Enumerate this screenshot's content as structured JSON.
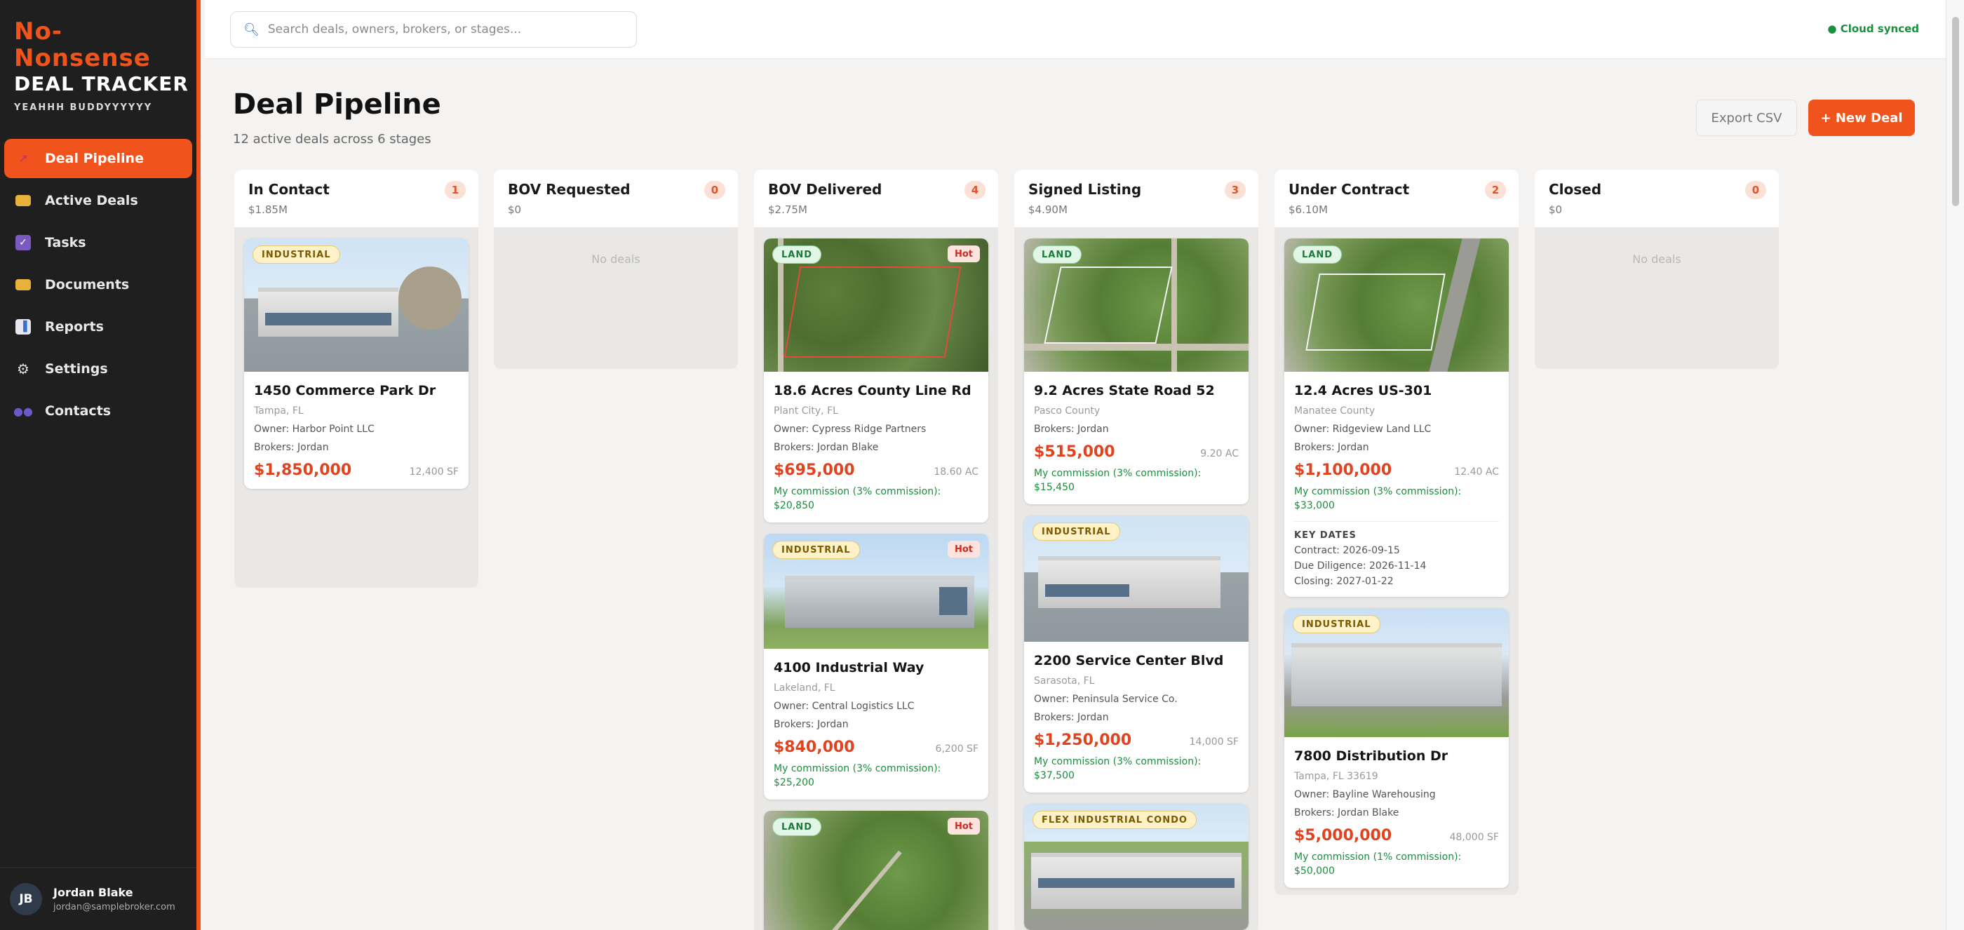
{
  "app": {
    "logo_line1": "No-",
    "logo_line2": "Nonsense",
    "logo_line3": "DEAL TRACKER",
    "tagline": "YEAHHH BUDDYYYYYY",
    "brand_color": "#f0541c"
  },
  "sidebar": {
    "items": [
      {
        "label": "Deal Pipeline",
        "icon": "pipeline-icon",
        "active": true
      },
      {
        "label": "Active Deals",
        "icon": "folder-icon",
        "active": false
      },
      {
        "label": "Tasks",
        "icon": "checkbox-icon",
        "active": false
      },
      {
        "label": "Documents",
        "icon": "folder-icon",
        "active": false
      },
      {
        "label": "Reports",
        "icon": "bar-chart-icon",
        "active": false
      },
      {
        "label": "Settings",
        "icon": "gear-icon",
        "active": false
      },
      {
        "label": "Contacts",
        "icon": "people-icon",
        "active": false
      }
    ],
    "user": {
      "initials": "JB",
      "name": "Jordan Blake",
      "email": "jordan@samplebroker.com"
    }
  },
  "topbar": {
    "search_placeholder": "Search deals, owners, brokers, or stages...",
    "sync_status": "● Cloud synced"
  },
  "header": {
    "title": "Deal Pipeline",
    "subtitle": "12 active deals across 6 stages",
    "export_label": "Export CSV",
    "new_deal_label": "+ New Deal"
  },
  "columns": [
    {
      "title": "In Contact",
      "count": "1",
      "total": "$1.85M",
      "cards": [
        {
          "tag": "INDUSTRIAL",
          "hot": "",
          "title": "1450 Commerce Park Dr",
          "location": "Tampa, FL",
          "owner": "Owner: Harbor Point LLC",
          "brokers": "Brokers: Jordan",
          "price": "$1,850,000",
          "size": "12,400 SF",
          "commission_1": "",
          "commission_2": ""
        }
      ]
    },
    {
      "title": "BOV Requested",
      "count": "0",
      "total": "$0",
      "empty_text": "No deals",
      "cards": []
    },
    {
      "title": "BOV Delivered",
      "count": "4",
      "total": "$2.75M",
      "cards": [
        {
          "tag": "LAND",
          "hot": "Hot",
          "title": "18.6 Acres County Line Rd",
          "location": "Plant City, FL",
          "owner": "Owner: Cypress Ridge Partners",
          "brokers": "Brokers: Jordan Blake",
          "price": "$695,000",
          "size": "18.60 AC",
          "commission_1": "My commission (3% commission):",
          "commission_2": "$20,850"
        },
        {
          "tag": "INDUSTRIAL",
          "hot": "Hot",
          "title": "4100 Industrial Way",
          "location": "Lakeland, FL",
          "owner": "Owner: Central Logistics LLC",
          "brokers": "Brokers: Jordan",
          "price": "$840,000",
          "size": "6,200 SF",
          "commission_1": "My commission (3% commission):",
          "commission_2": "$25,200"
        },
        {
          "tag": "LAND",
          "hot": "Hot"
        }
      ]
    },
    {
      "title": "Signed Listing",
      "count": "3",
      "total": "$4.90M",
      "cards": [
        {
          "tag": "LAND",
          "hot": "",
          "title": "9.2 Acres State Road 52",
          "location": "Pasco County",
          "owner": "",
          "brokers": "Brokers: Jordan",
          "price": "$515,000",
          "size": "9.20 AC",
          "commission_1": "My commission (3% commission):",
          "commission_2": "$15,450"
        },
        {
          "tag": "INDUSTRIAL",
          "hot": "",
          "title": "2200 Service Center Blvd",
          "location": "Sarasota, FL",
          "owner": "Owner: Peninsula Service Co.",
          "brokers": "Brokers: Jordan",
          "price": "$1,250,000",
          "size": "14,000 SF",
          "commission_1": "My commission (3% commission):",
          "commission_2": "$37,500"
        },
        {
          "tag": "FLEX INDUSTRIAL CONDO",
          "hot": ""
        }
      ]
    },
    {
      "title": "Under Contract",
      "count": "2",
      "total": "$6.10M",
      "cards": [
        {
          "tag": "LAND",
          "hot": "",
          "title": "12.4 Acres US-301",
          "location": "Manatee County",
          "owner": "Owner: Ridgeview Land LLC",
          "brokers": "Brokers: Jordan",
          "price": "$1,100,000",
          "size": "12.40 AC",
          "commission_1": "My commission (3% commission):",
          "commission_2": "$33,000",
          "key_dates": {
            "title": "KEY DATES",
            "contract": "Contract: 2026-09-15",
            "due_diligence": "Due Diligence: 2026-11-14",
            "closing": "Closing: 2027-01-22"
          }
        },
        {
          "tag": "INDUSTRIAL",
          "hot": "",
          "title": "7800 Distribution Dr",
          "location": "Tampa, FL 33619",
          "owner": "Owner: Bayline Warehousing",
          "brokers": "Brokers: Jordan Blake",
          "price": "$5,000,000",
          "size": "48,000 SF",
          "commission_1": "My commission (1% commission):",
          "commission_2": "$50,000"
        }
      ]
    },
    {
      "title": "Closed",
      "count": "0",
      "total": "$0",
      "empty_text": "No deals",
      "cards": []
    }
  ]
}
